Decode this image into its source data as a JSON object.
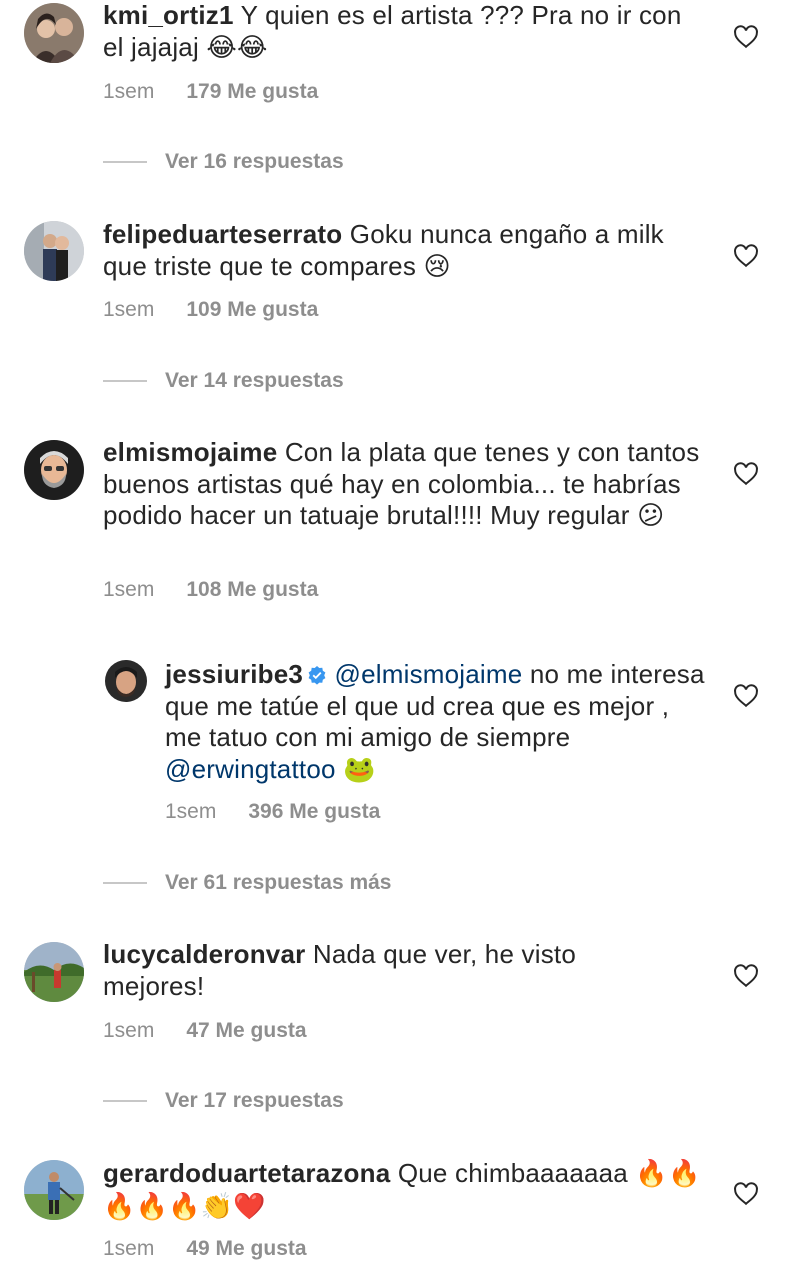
{
  "comments": [
    {
      "username": "kmi_ortiz1",
      "text_before": "Y quien es el artista ??? Pra no ir con el jajajaj",
      "emoji": "😂😂",
      "time": "1sem",
      "likes": "179 Me gusta",
      "replies": "Ver 16 respuestas"
    },
    {
      "username": "felipeduarteserrato",
      "text_before": "Goku nunca engaño a milk que triste que te compares",
      "emoji": "😢",
      "time": "1sem",
      "likes": "109 Me gusta",
      "replies": "Ver 14 respuestas"
    },
    {
      "username": "elmismojaime",
      "text_before": "Con la plata que tenes y con tantos buenos artistas qué hay en colombia... te habrías podido hacer un tatuaje brutal!!!! Muy regular",
      "emoji": "😕",
      "time": "1sem",
      "likes": "108 Me gusta",
      "reply": {
        "username": "jessiuribe3",
        "mention1": "@elmismojaime",
        "text_mid": "no me interesa que me tatúe el que ud crea que es mejor , me tatuo con mi amigo de siempre",
        "mention2": "@erwingtattoo",
        "emoji": "🐸",
        "time": "1sem",
        "likes": "396 Me gusta"
      },
      "replies": "Ver 61 respuestas más"
    },
    {
      "username": "lucycalderonvar",
      "text_before": "Nada que ver, he visto mejores!",
      "emoji": "",
      "time": "1sem",
      "likes": "47 Me gusta",
      "replies": "Ver 17 respuestas"
    },
    {
      "username": "gerardoduartetarazona",
      "text_before": "Que chimbaaaaaaa",
      "emoji": "🔥🔥🔥🔥🔥👏❤️",
      "time": "1sem",
      "likes": "49 Me gusta"
    }
  ],
  "icons": {
    "like": "heart-outline-icon",
    "verified": "verified-badge-icon"
  },
  "colors": {
    "text": "#262626",
    "secondary": "#8e8e8e",
    "mention": "#00376b",
    "verified": "#3897f0"
  }
}
